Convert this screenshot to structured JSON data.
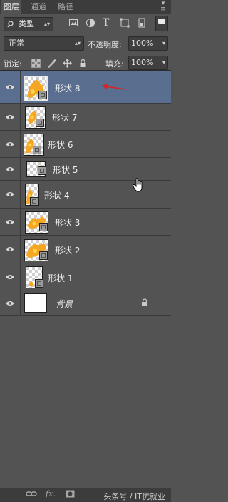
{
  "tabs": [
    {
      "label": "图层"
    },
    {
      "label": "通道"
    },
    {
      "label": "路径"
    }
  ],
  "filter": {
    "type_label": "类型",
    "icon": "search-icon"
  },
  "blend": {
    "mode": "正常",
    "opacity_label": "不透明度:",
    "opacity_value": "100%"
  },
  "lock": {
    "label": "锁定:",
    "fill_label": "填充:",
    "fill_value": "100%"
  },
  "layers": [
    {
      "name": "形状 8",
      "selected": true
    },
    {
      "name": "形状 7"
    },
    {
      "name": "形状 6"
    },
    {
      "name": "形状 5"
    },
    {
      "name": "形状 4"
    },
    {
      "name": "形状 3"
    },
    {
      "name": "形状 2"
    },
    {
      "name": "形状 1"
    },
    {
      "name": "背景"
    }
  ],
  "footer": {
    "fx_label": "fx.",
    "watermark": "头条号 / IT优就业"
  },
  "colors": {
    "selected_row": "#5a6e8f",
    "shape_orange": "#f5a623",
    "arrow_red": "#e02020"
  }
}
